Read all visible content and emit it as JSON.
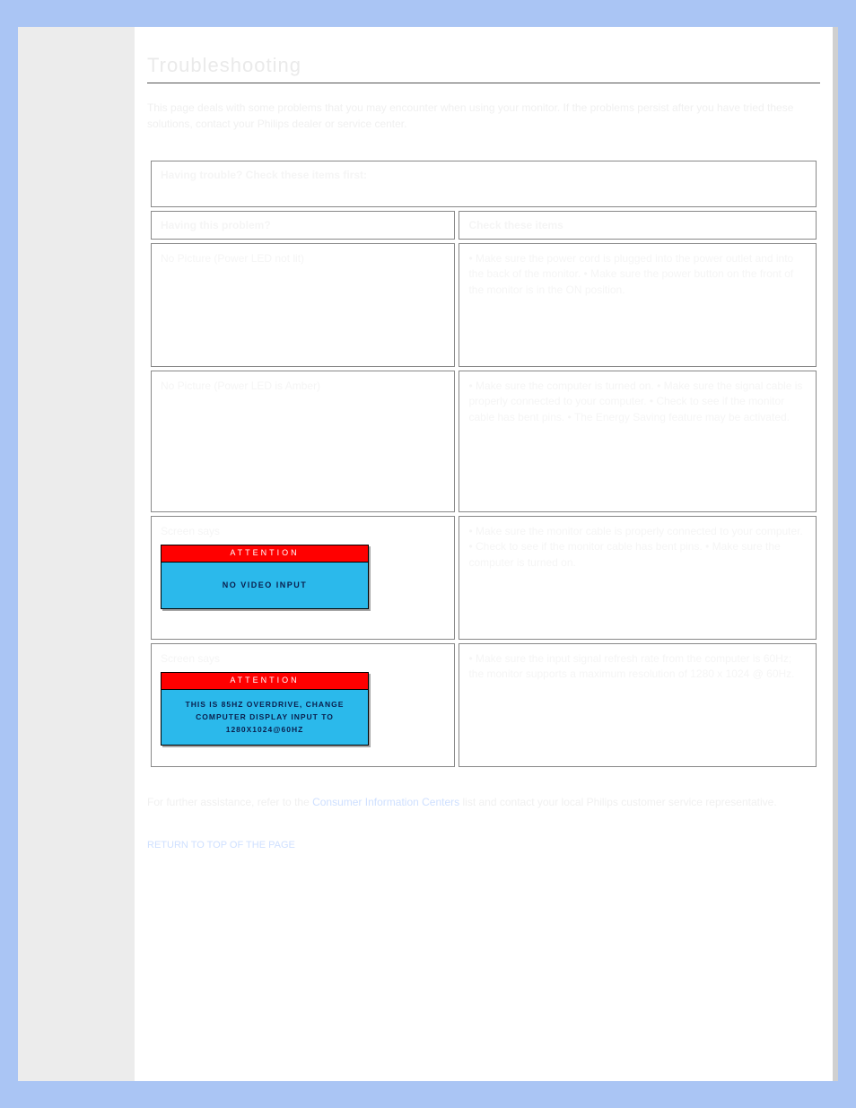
{
  "header": {
    "title": "Troubleshooting",
    "lead": "This page deals with some problems that you may encounter when using your monitor. If the problems persist after you have tried these solutions, contact your Philips dealer or service center."
  },
  "table": {
    "banner": "Having trouble? Check these items first:",
    "col1": "Having this problem?",
    "col2": "Check these items",
    "rows": [
      {
        "problem": "No Picture (Power LED not lit)",
        "solution": "• Make sure the power cord is plugged into the power outlet and into the back of the monitor.\n• Make sure the power button on the front of the monitor is in the ON position."
      },
      {
        "problem": "No Picture (Power LED is Amber)",
        "solution": "• Make sure the computer is turned on.\n• Make sure the signal cable is properly connected to your computer.\n• Check to see if the monitor cable has bent pins.\n• The Energy Saving feature may be activated."
      },
      {
        "problem_img": {
          "header": "ATTENTION",
          "body": "NO VIDEO INPUT"
        },
        "problem": "Screen says",
        "solution": "• Make sure the monitor cable is properly connected to your computer.\n• Check to see if the monitor cable has bent pins.\n• Make sure the computer is turned on."
      },
      {
        "problem_img": {
          "header": "ATTENTION",
          "body": "THIS IS 85HZ OVERDRIVE, CHANGE COMPUTER DISPLAY INPUT TO 1280X1024@60HZ"
        },
        "problem": "Screen says",
        "solution": "• Make sure the input signal refresh rate from the computer is 60Hz; the monitor supports a maximum resolution of 1280 x 1024 @ 60Hz."
      }
    ]
  },
  "footer": {
    "note": "For further assistance, refer to the Consumer Information Centers list and contact your local Philips customer service representative.",
    "link_text": "Consumer Information Centers",
    "back": "RETURN TO TOP OF THE PAGE"
  }
}
